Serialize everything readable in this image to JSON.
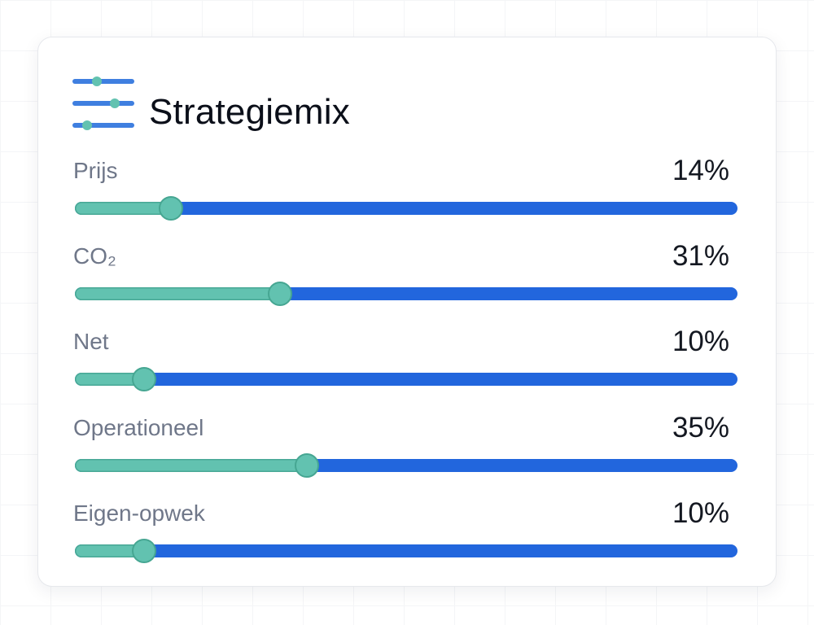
{
  "panel": {
    "title": "Strategiemix",
    "icon": "sliders-icon",
    "colors": {
      "track": "#2266dd",
      "fill": "#62c2b0",
      "thumb_border": "#46a692",
      "label": "#6f7789",
      "value": "#141821"
    }
  },
  "sliders": [
    {
      "label": "Prijs",
      "value_text": "14%",
      "position": 0.145
    },
    {
      "label": "CO₂",
      "value_text": "31%",
      "position": 0.31
    },
    {
      "label": "Net",
      "value_text": "10%",
      "position": 0.105
    },
    {
      "label": "Operationeel",
      "value_text": "35%",
      "position": 0.35
    },
    {
      "label": "Eigen-opwek",
      "value_text": "10%",
      "position": 0.105
    }
  ]
}
